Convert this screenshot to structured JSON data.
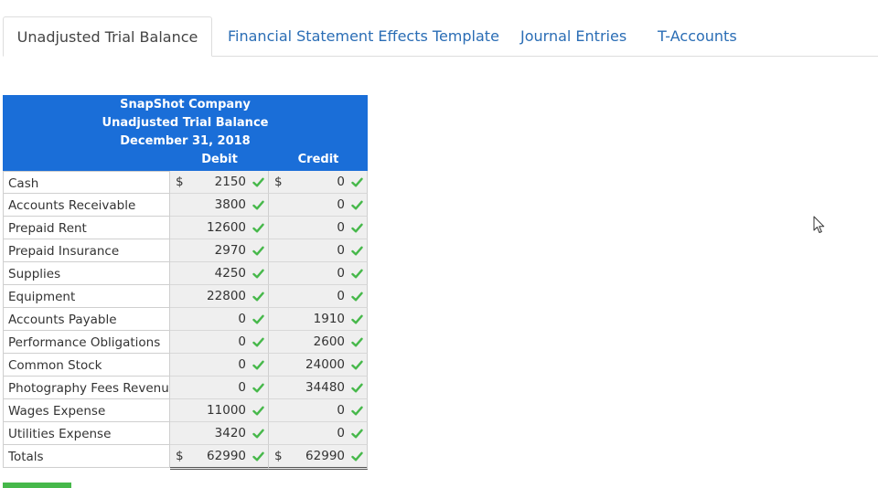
{
  "tabs": [
    {
      "label": "Unadjusted Trial Balance",
      "active": true
    },
    {
      "label": "Financial Statement Effects Template",
      "active": false
    },
    {
      "label": "Journal Entries",
      "active": false
    },
    {
      "label": "T-Accounts",
      "active": false
    }
  ],
  "trial_balance": {
    "company": "SnapShot Company",
    "title": "Unadjusted Trial Balance",
    "date": "December 31, 2018",
    "debit_header": "Debit",
    "credit_header": "Credit",
    "currency_symbol": "$",
    "check_color": "#46b84a",
    "header_color": "#1a6ed8",
    "rows": [
      {
        "account": "Cash",
        "debit": "2150",
        "credit": "0",
        "show_currency": true
      },
      {
        "account": "Accounts Receivable",
        "debit": "3800",
        "credit": "0"
      },
      {
        "account": "Prepaid Rent",
        "debit": "12600",
        "credit": "0"
      },
      {
        "account": "Prepaid Insurance",
        "debit": "2970",
        "credit": "0"
      },
      {
        "account": "Supplies",
        "debit": "4250",
        "credit": "0"
      },
      {
        "account": "Equipment",
        "debit": "22800",
        "credit": "0"
      },
      {
        "account": "Accounts Payable",
        "debit": "0",
        "credit": "1910"
      },
      {
        "account": "Performance Obligations",
        "debit": "0",
        "credit": "2600"
      },
      {
        "account": "Common Stock",
        "debit": "0",
        "credit": "24000"
      },
      {
        "account": "Photography Fees Revenue",
        "debit": "0",
        "credit": "34480"
      },
      {
        "account": "Wages Expense",
        "debit": "11000",
        "credit": "0"
      },
      {
        "account": "Utilities Expense",
        "debit": "3420",
        "credit": "0"
      }
    ],
    "totals": {
      "label": "Totals",
      "debit": "62990",
      "credit": "62990"
    }
  },
  "icons": {
    "check": "check-icon",
    "cursor": "mouse-pointer-icon"
  }
}
